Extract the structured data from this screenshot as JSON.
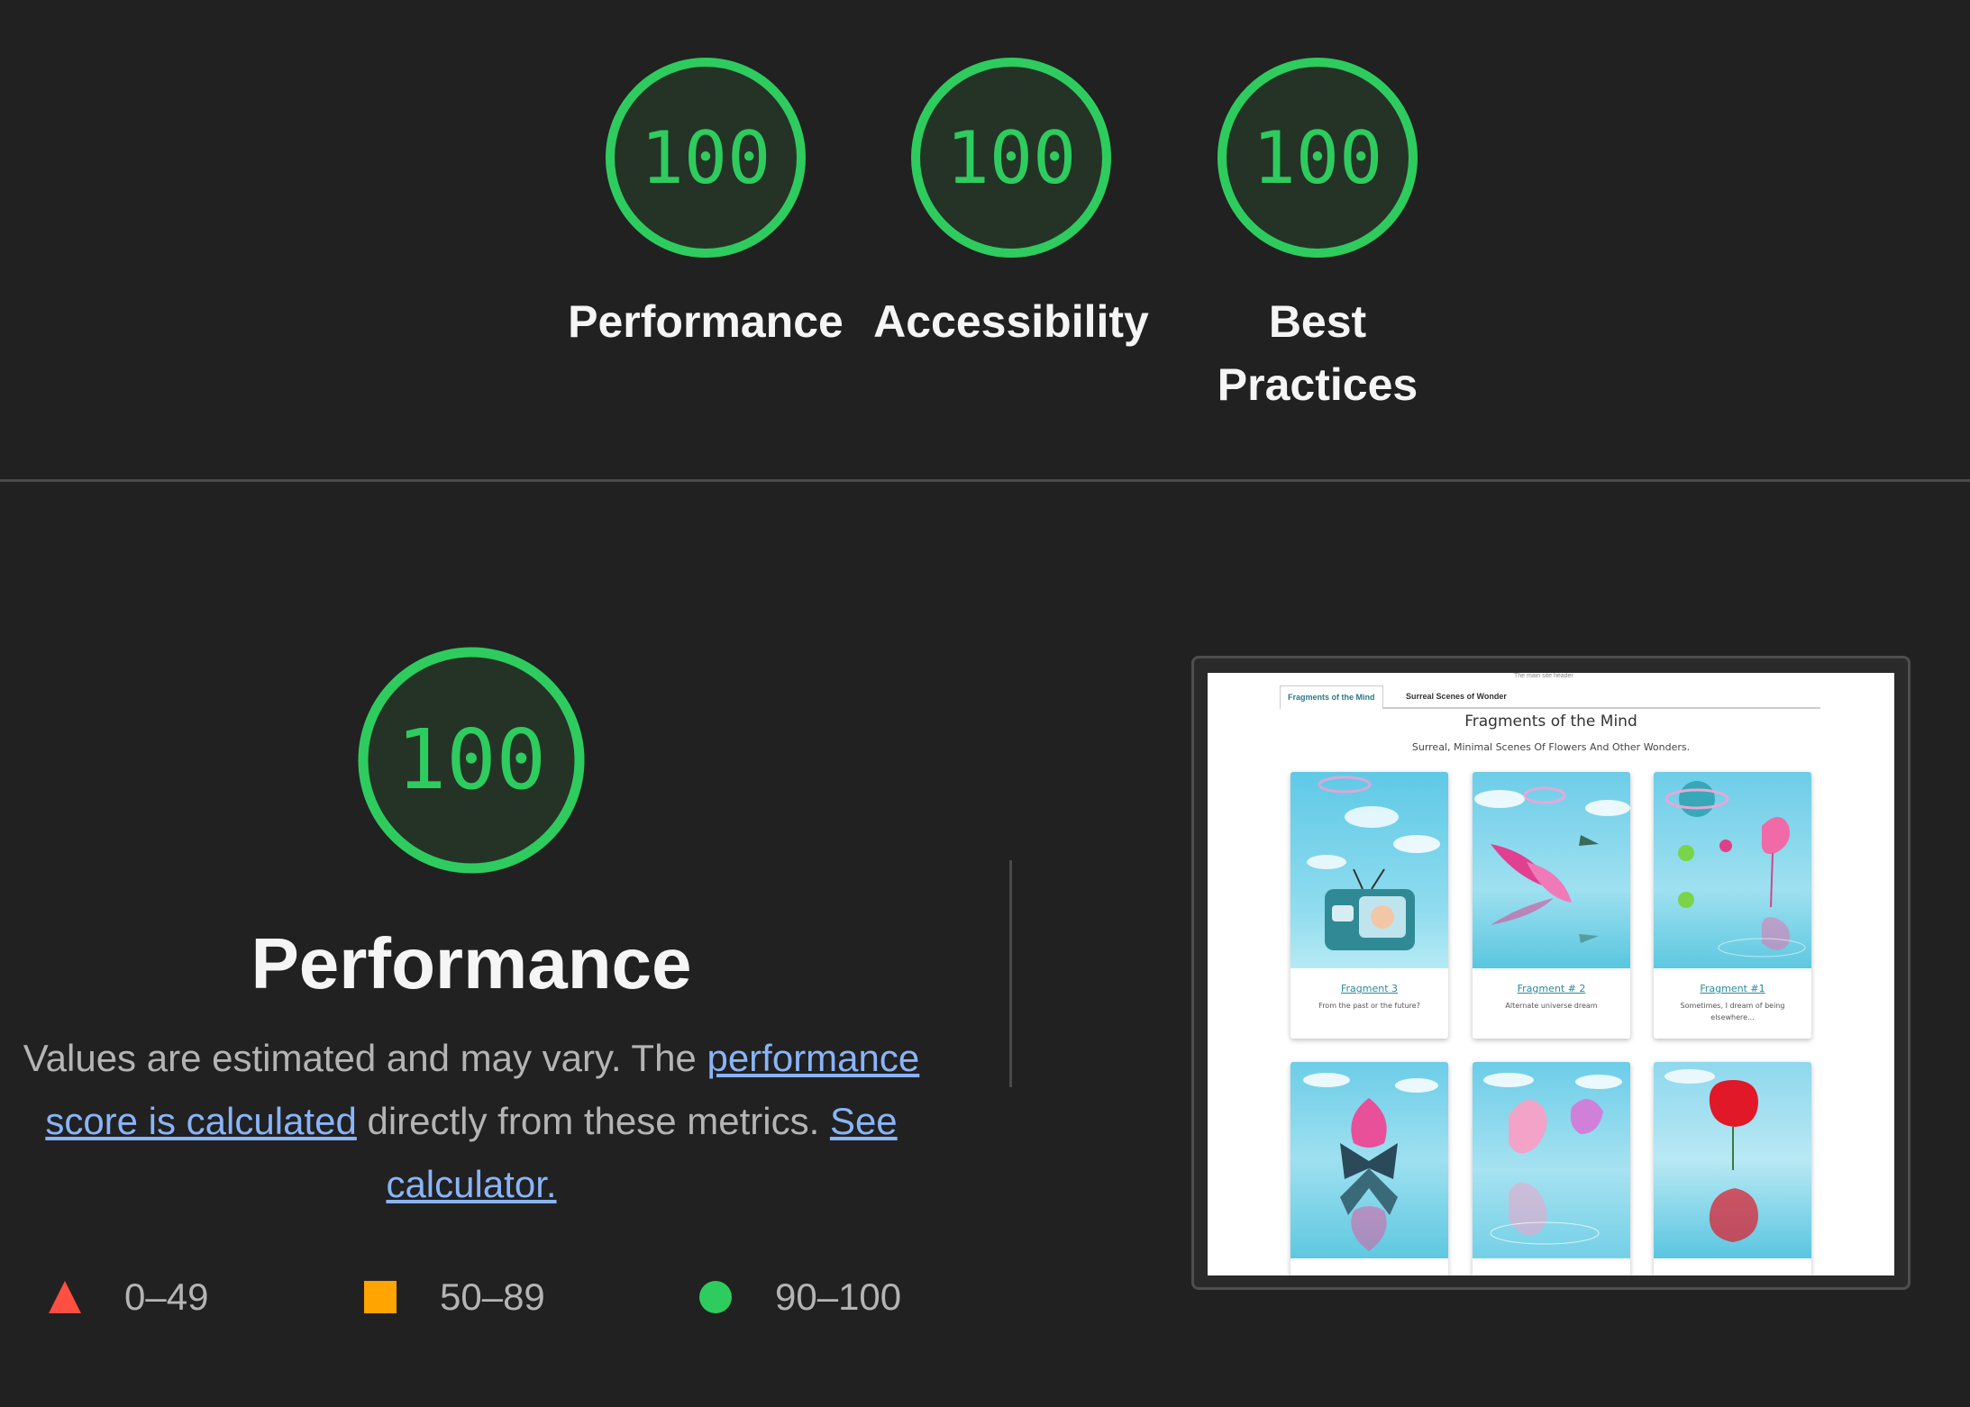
{
  "top_scores": [
    {
      "score": "100",
      "label": "Performance"
    },
    {
      "score": "100",
      "label": "Accessibility"
    },
    {
      "score": "100",
      "label_line1": "Best",
      "label_line2": "Practices"
    }
  ],
  "performance": {
    "score": "100",
    "title": "Performance",
    "desc_prefix": "Values are estimated and may vary. The ",
    "link1": "performance score is calculated",
    "desc_middle": " directly from these metrics. ",
    "link2": "See calculator."
  },
  "legend": [
    {
      "range": "0–49",
      "color": "#ff4e42",
      "icon": "triangle-icon"
    },
    {
      "range": "50–89",
      "color": "#ffa400",
      "icon": "square-icon"
    },
    {
      "range": "90–100",
      "color": "#2ecc5e",
      "icon": "circle-icon"
    }
  ],
  "colors": {
    "pass": "#2ecc5e",
    "background": "#212121",
    "link": "#8ab4f8"
  },
  "screenshot": {
    "top_text": "The main site header",
    "tabs": [
      "Fragments of the Mind",
      "Surreal Scenes of Wonder"
    ],
    "title": "Fragments of the Mind",
    "subtitle": "Surreal, Minimal Scenes Of Flowers And Other Wonders.",
    "cards": [
      {
        "title": "Fragment 3",
        "desc": "From the past or the future?"
      },
      {
        "title": "Fragment # 2",
        "desc": "Alternate universe dream"
      },
      {
        "title": "Fragment #1",
        "desc": "Sometimes, I dream of being elsewhere..."
      }
    ]
  }
}
